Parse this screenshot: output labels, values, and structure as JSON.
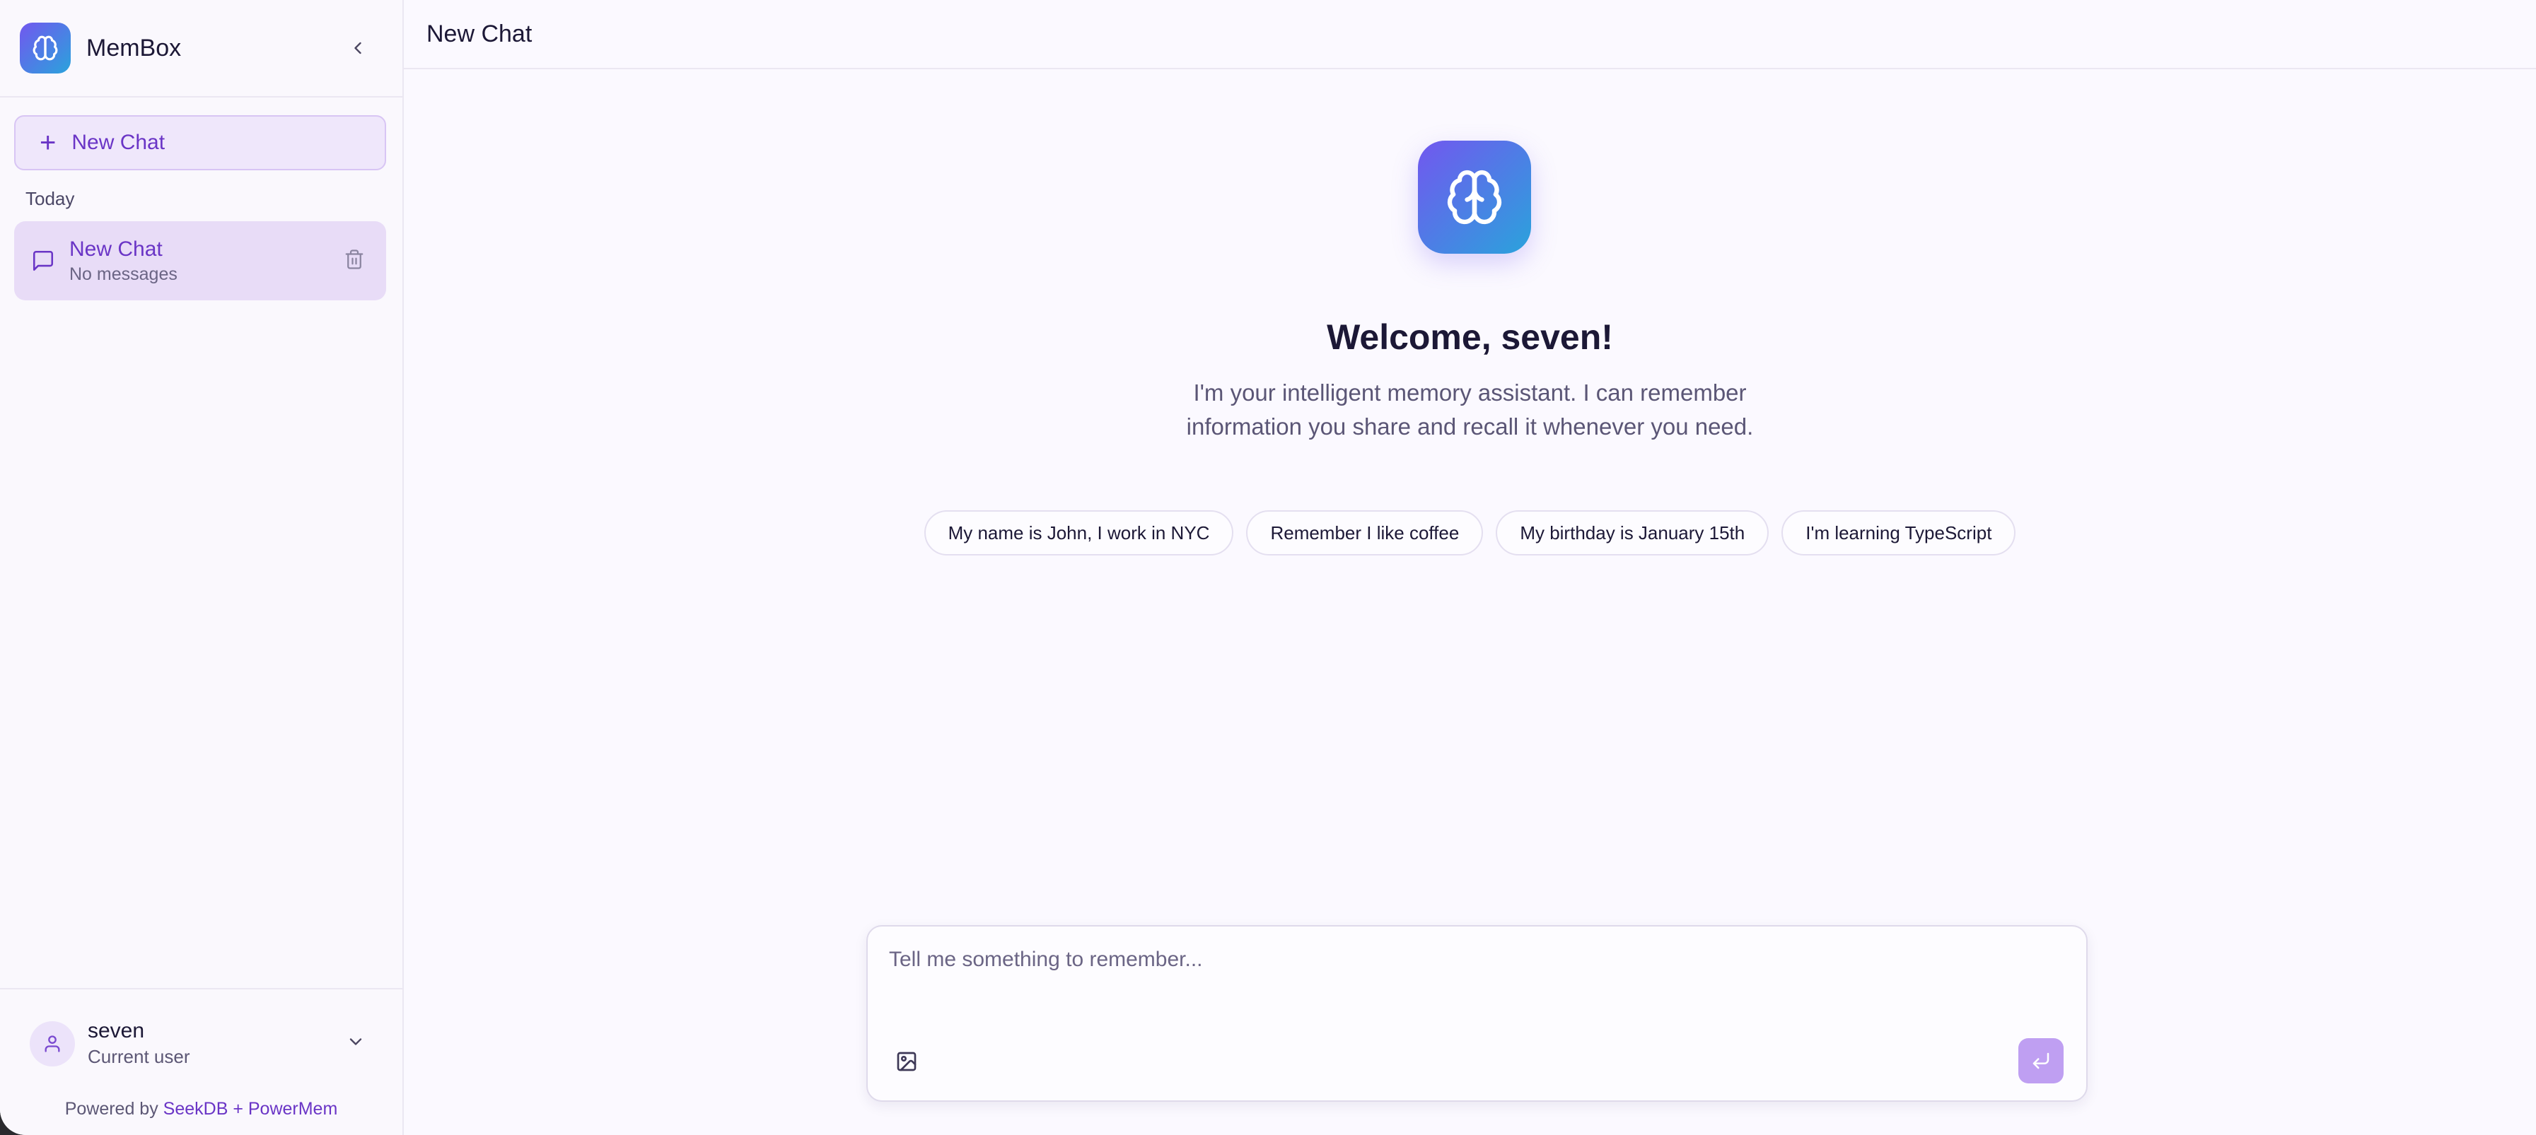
{
  "app": {
    "name": "MemBox"
  },
  "sidebar": {
    "new_chat_label": "New Chat",
    "section_label": "Today",
    "chats": [
      {
        "title": "New Chat",
        "subtitle": "No messages"
      }
    ],
    "user": {
      "name": "seven",
      "role": "Current user"
    },
    "powered_by": {
      "prefix": "Powered by",
      "brand": "SeekDB + PowerMem"
    }
  },
  "main": {
    "title": "New Chat",
    "welcome": "Welcome, seven!",
    "subtitle": "I'm your intelligent memory assistant. I can remember information you share and recall it whenever you need.",
    "suggestions": [
      "My name is John, I work in NYC",
      "Remember I like coffee",
      "My birthday is January 15th",
      "I'm learning TypeScript"
    ],
    "composer": {
      "placeholder": "Tell me something to remember..."
    }
  },
  "colors": {
    "accent": "#6a35c6",
    "gradient_start": "#7257ef",
    "gradient_end": "#2aa3dc",
    "send_button": "#bf9ff2"
  },
  "icons": {
    "logo": "brain-icon",
    "collapse": "chevron-left-icon",
    "chat": "message-square-icon",
    "delete": "trash-icon",
    "user": "user-icon",
    "user_menu": "chevron-down-icon",
    "image": "image-icon",
    "send": "enter-arrow-icon"
  }
}
